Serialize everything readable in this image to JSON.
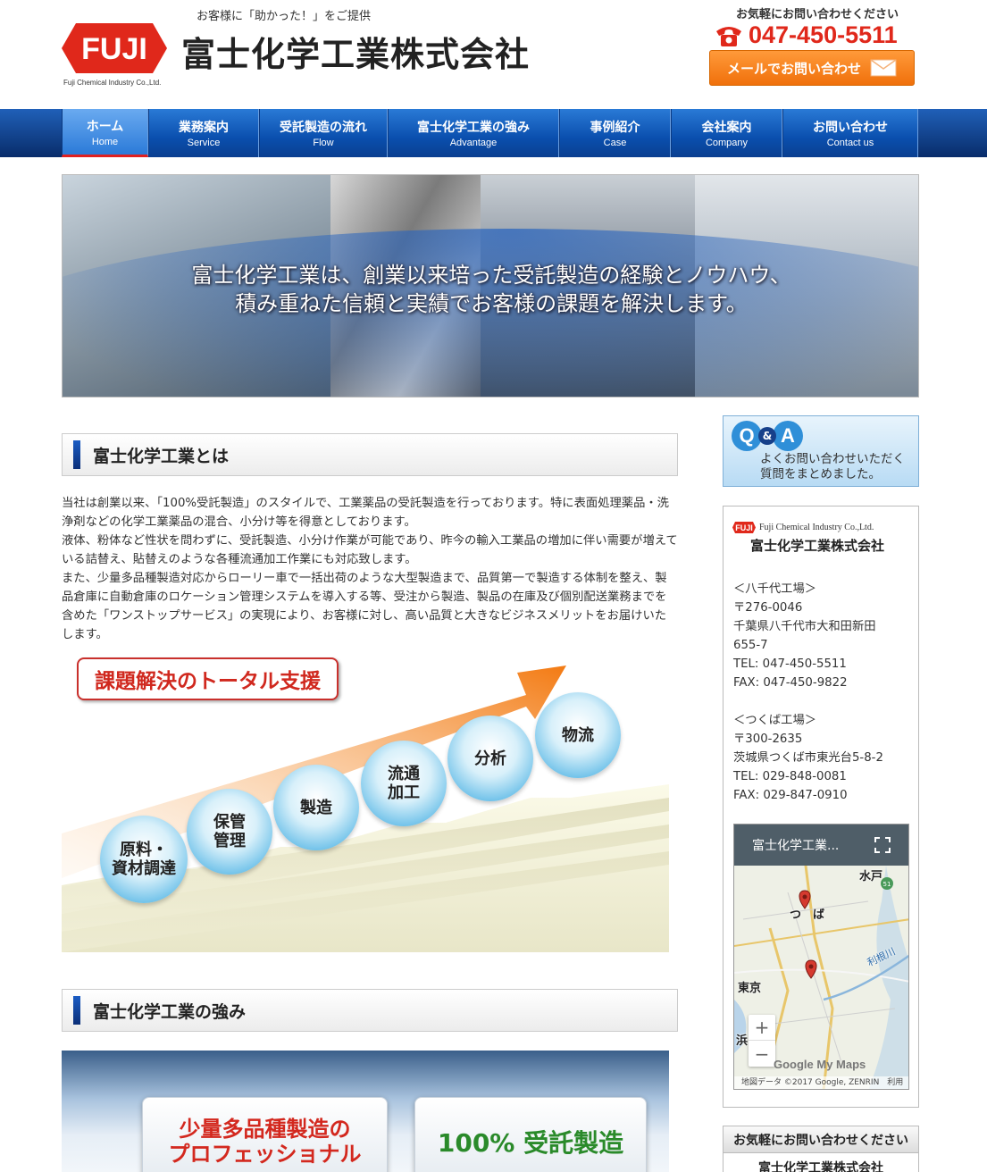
{
  "header": {
    "tagline": "お客様に「助かった！」をご提供",
    "logo_text": "FUJI",
    "logo_sub": "Fuji Chemical Industry Co.,Ltd.",
    "company_name": "富士化学工業株式会社",
    "contact_label": "お気軽にお問い合わせください",
    "phone": "047-450-5511",
    "mail_button": "メールでお問い合わせ"
  },
  "nav": {
    "items": [
      {
        "jp": "ホーム",
        "en": "Home",
        "active": true
      },
      {
        "jp": "業務案内",
        "en": "Service"
      },
      {
        "jp": "受託製造の流れ",
        "en": "Flow"
      },
      {
        "jp": "富士化学工業の強み",
        "en": "Advantage"
      },
      {
        "jp": "事例紹介",
        "en": "Case"
      },
      {
        "jp": "会社案内",
        "en": "Company"
      },
      {
        "jp": "お問い合わせ",
        "en": "Contact us"
      }
    ]
  },
  "hero": {
    "line1": "富士化学工業は、創業以来培った受託製造の経験とノウハウ、",
    "line2": "積み重ねた信頼と実績でお客様の課題を解決します。"
  },
  "about": {
    "heading": "富士化学工業とは",
    "paragraphs": [
      "当社は創業以来、「100%受託製造」のスタイルで、工業薬品の受託製造を行っております。特に表面処理薬品・洗浄剤などの化学工業薬品の混合、小分け等を得意としております。",
      "液体、粉体など性状を問わずに、受託製造、小分け作業が可能であり、昨今の輸入工業品の増加に伴い需要が増えている詰替え、貼替えのような各種流通加工作業にも対応致します。",
      "また、少量多品種製造対応からローリー車で一括出荷のような大型製造まで、品質第一で製造する体制を整え、製品倉庫に自動倉庫のロケーション管理システムを導入する等、受注から製造、製品の在庫及び個別配送業務までを含めた「ワンストップサービス」の実現により、お客様に対し、高い品質と大きなビジネスメリットをお届けいたします。"
    ]
  },
  "diagram": {
    "title": "課題解決のトータル支援",
    "steps": [
      "原料・\n資材調達",
      "保管\n管理",
      "製造",
      "流通\n加工",
      "分析",
      "物流"
    ]
  },
  "strength": {
    "heading": "富士化学工業の強み",
    "card1_line1": "少量多品種製造の",
    "card1_line2": "プロフェッショナル",
    "card2": "100% 受託製造"
  },
  "sidebar": {
    "qa": {
      "q": "Q",
      "amp": "&",
      "a": "A",
      "line1": "よくお問い合わせいただく",
      "line2": "質問をまとめました。"
    },
    "info": {
      "logo_en": "Fuji Chemical Industry Co.,Ltd.",
      "name": "富士化学工業株式会社",
      "yachiyo_title": "＜八千代工場＞",
      "yachiyo_zip": "〒276-0046",
      "yachiyo_addr1": "千葉県八千代市大和田新田",
      "yachiyo_addr2": "655-7",
      "yachiyo_tel": "TEL: 047-450-5511",
      "yachiyo_fax": "FAX: 047-450-9822",
      "tsukuba_title": "＜つくば工場＞",
      "tsukuba_zip": "〒300-2635",
      "tsukuba_addr": "茨城県つくば市東光台5-8-2",
      "tsukuba_tel": "TEL: 029-848-0081",
      "tsukuba_fax": "FAX: 029-847-0910"
    },
    "map": {
      "title": "富士化学工業...",
      "label_mito": "水戸",
      "label_tsukuba": "つ　ば",
      "label_tokyo": "東京",
      "label_hama": "浜",
      "label_tone": "利根川",
      "road_51": "51",
      "zoom_in": "+",
      "zoom_out": "−",
      "google": "Google My Maps",
      "footer": "地図データ ©2017 Google, ZENRIN　利用"
    },
    "contact": {
      "head": "お気軽にお問い合わせください",
      "name": "富士化学工業株式会社"
    }
  },
  "colors": {
    "brand_red": "#e0281b",
    "nav_blue": "#0a4fae",
    "accent_orange": "#f0700b"
  }
}
